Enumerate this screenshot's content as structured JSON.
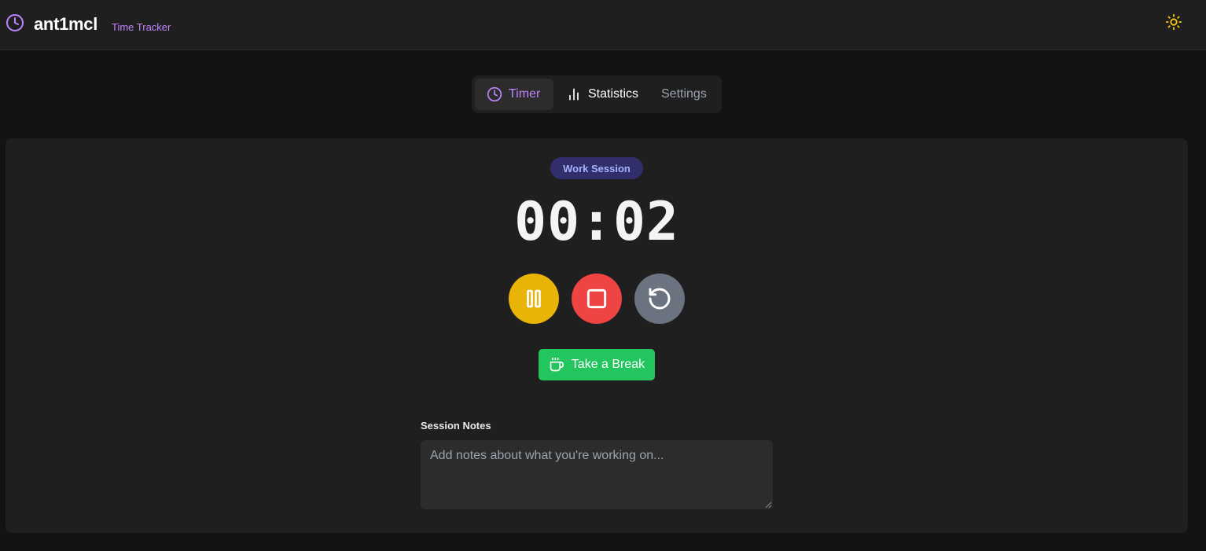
{
  "app": {
    "name": "ant1mcl",
    "subtitle": "Time Tracker",
    "brand_icon": "clock-icon",
    "theme_icon": "sun-icon"
  },
  "tabs": [
    {
      "label": "Timer",
      "icon": "clock-icon",
      "active": true
    },
    {
      "label": "Statistics",
      "icon": "bar-chart-icon",
      "active": false
    },
    {
      "label": "Settings",
      "icon": "",
      "active": false
    }
  ],
  "timer": {
    "session_label": "Work Session",
    "time": "00:02",
    "controls": [
      {
        "name": "pause",
        "icon": "pause-icon",
        "color": "#eab308"
      },
      {
        "name": "stop",
        "icon": "stop-icon",
        "color": "#ef4444"
      },
      {
        "name": "reset",
        "icon": "reset-icon",
        "color": "#6b7280"
      }
    ],
    "break_label": "Take a Break",
    "break_icon": "coffee-icon"
  },
  "notes": {
    "label": "Session Notes",
    "placeholder": "Add notes about what you're working on...",
    "value": ""
  },
  "colors": {
    "accent": "#c084fc",
    "background": "#131313",
    "card": "#1f1f1f",
    "break_button": "#22c55e",
    "badge_bg": "#312e6b",
    "badge_text": "#a5b4fc",
    "theme_icon": "#facc15"
  }
}
